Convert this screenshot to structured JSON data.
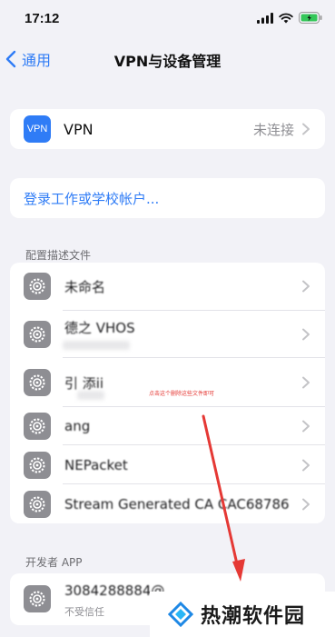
{
  "status_bar": {
    "time": "17:12"
  },
  "nav": {
    "back_label": "通用",
    "title": "VPN与设备管理"
  },
  "vpn_row": {
    "icon_text": "VPN",
    "label": "VPN",
    "value": "未连接"
  },
  "account_link": "登录工作或学校帐户...",
  "profiles": {
    "section_title": "配置描述文件",
    "items": [
      {
        "name": "未命名"
      },
      {
        "name": "德之 VHOS"
      },
      {
        "name": "引 添ii"
      },
      {
        "name": "ang"
      },
      {
        "name": "NEPacket"
      },
      {
        "name": "Stream Generated CA CAC68786"
      }
    ]
  },
  "annotation": "点击这个删除这些文件即可",
  "developer": {
    "section_title": "开发者 APP",
    "name": "3084288884@",
    "status": "不受信任"
  },
  "watermark": {
    "text": "热潮软件园"
  },
  "colors": {
    "accent": "#2f7cf6",
    "background": "#f2f2f7",
    "arrow": "#e53935",
    "battery": "#34c759"
  }
}
